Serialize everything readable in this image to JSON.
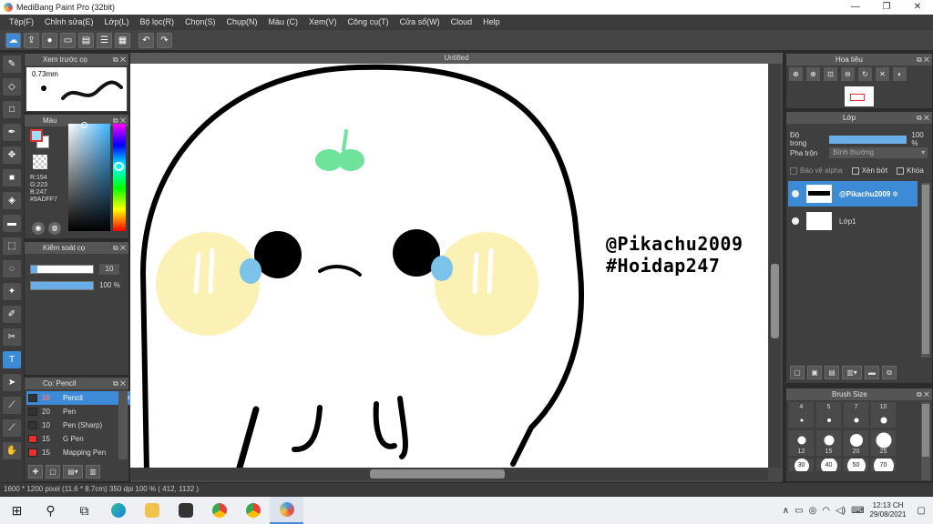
{
  "window": {
    "title": "MediBang Paint Pro (32bit)",
    "controls": [
      "—",
      "❐",
      "✕"
    ]
  },
  "menu": [
    "Tệp(F)",
    "Chỉnh sửa(E)",
    "Lớp(L)",
    "Bộ lọc(R)",
    "Chọn(S)",
    "Chụp(N)",
    "Màu (C)",
    "Xem(V)",
    "Công cụ(T)",
    "Cửa sổ(W)",
    "Cloud",
    "Help"
  ],
  "toolbar_icons": [
    "cloud-icon",
    "upload-icon",
    "comment-icon",
    "message-icon",
    "page-icon",
    "settings-list-icon",
    "grid-icon",
    "undo-icon",
    "redo-icon"
  ],
  "tools": [
    "brush-icon",
    "eraser-icon",
    "rectangle-icon",
    "pen-tool-icon",
    "move-icon",
    "fill-rect-icon",
    "bucket-icon",
    "gradient-icon",
    "select-rect-icon",
    "lasso-icon",
    "magic-wand-icon",
    "select-pen-icon",
    "select-eraser-icon",
    "text-icon",
    "operation-icon",
    "eyedropper-icon",
    "eyedropper2-icon",
    "hand-icon"
  ],
  "brush_preview": {
    "title": "Xem trước cọ",
    "size": "0.73mm"
  },
  "color": {
    "title": "Màu",
    "r": "R:154",
    "g": "G:223",
    "b": "B:247",
    "hex": "#9ADFF7",
    "fg_color": "#9ADFF7"
  },
  "brush_control": {
    "title": "Kiểm soát cọ",
    "size_value": "10",
    "opacity_value": "100 %",
    "size_level": 0.1,
    "opacity_level": 1.0
  },
  "brushes": {
    "title": "Cọ: Pencil",
    "items": [
      {
        "size": "10",
        "name": "Pencil",
        "red": false,
        "active": true
      },
      {
        "size": "20",
        "name": "Pen",
        "red": false,
        "active": false
      },
      {
        "size": "10",
        "name": "Pen (Sharp)",
        "red": false,
        "active": false
      },
      {
        "size": "15",
        "name": "G Pen",
        "red": true,
        "active": false
      },
      {
        "size": "15",
        "name": "Mapping Pen",
        "red": true,
        "active": false
      }
    ]
  },
  "document": {
    "tab": "Untitled",
    "watermark_line1": "@Pikachu2009",
    "watermark_line2": "#Hoidap247"
  },
  "status": {
    "text": "1600 * 1200 pixel   (11.6 * 8.7cm)   350 dpi   100 %   ( 412, 1132 )"
  },
  "navigator": {
    "title": "Hoa tiêu"
  },
  "layer": {
    "title": "Lớp",
    "opacity_label": "Độ trong",
    "opacity_value": "100 %",
    "blend_label": "Pha trộn",
    "blend_value": "Bình thường",
    "protect_alpha": "Bảo vệ alpha",
    "clip": "Xén bớt",
    "lock": "Khóa",
    "items": [
      {
        "name": "@Pikachu2009",
        "active": true
      },
      {
        "name": "Lớp1",
        "active": false
      }
    ]
  },
  "brush_size": {
    "title": "Brush Size",
    "cells": [
      "4",
      "5",
      "7",
      "10",
      "12",
      "15",
      "20",
      "25",
      "30",
      "40",
      "50",
      "70"
    ]
  },
  "taskbar": {
    "time": "12:13 CH",
    "date": "29/08/2021"
  }
}
